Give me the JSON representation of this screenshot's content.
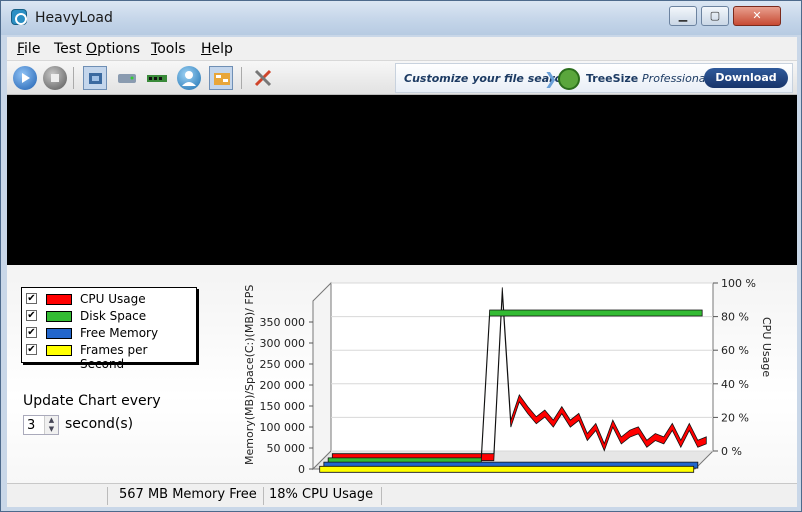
{
  "window": {
    "title": "HeavyLoad"
  },
  "menu": [
    {
      "pre": "",
      "ul": "F",
      "post": "ile"
    },
    {
      "pre": "Test ",
      "ul": "O",
      "post": "ptions"
    },
    {
      "pre": "",
      "ul": "T",
      "post": "ools"
    },
    {
      "pre": "",
      "ul": "H",
      "post": "elp"
    }
  ],
  "toolbar_icons": [
    "start-icon",
    "stop-icon",
    "cpu-icon",
    "disk-icon",
    "memory-icon",
    "fps-icon",
    "settings-icon"
  ],
  "ad": {
    "text": "Customize your file search",
    "brand": "TreeSize",
    "brand_suffix": "Professional",
    "download": "Download"
  },
  "legend": [
    {
      "label": "CPU Usage",
      "color": "#ff0000",
      "checked": "✔"
    },
    {
      "label": "Disk Space",
      "color": "#33bb33",
      "checked": "✔"
    },
    {
      "label": "Free Memory",
      "color": "#2266cc",
      "checked": "✔"
    },
    {
      "label": "Frames per Second",
      "color": "#ffff00",
      "checked": "✔"
    }
  ],
  "update": {
    "label": "Update Chart every",
    "value": "3",
    "unit": "second(s)"
  },
  "chart_data": {
    "type": "line",
    "left_axis_label": "Memory(MB)/Space(C:)(MB)/ FPS",
    "right_axis_label": "CPU Usage",
    "left_ticks": [
      "0",
      "50 000",
      "100 000",
      "150 000",
      "200 000",
      "250 000",
      "300 000",
      "350 000"
    ],
    "left_ylim": [
      0,
      400000
    ],
    "right_ticks": [
      "0 %",
      "20 %",
      "40 %",
      "60 %",
      "80 %",
      "100 %"
    ],
    "right_ylim": [
      0,
      100
    ],
    "x": [
      0,
      1,
      2,
      3,
      4,
      5,
      6,
      7,
      8,
      9,
      10,
      11,
      12,
      13,
      14,
      15,
      16,
      17,
      18,
      19,
      20,
      21,
      22,
      23,
      24,
      25,
      26,
      27,
      28,
      29,
      30,
      31,
      32,
      33,
      34,
      35,
      36,
      37,
      38,
      39,
      40,
      41,
      42,
      43,
      44
    ],
    "series": [
      {
        "name": "CPU Usage",
        "color": "#ff0000",
        "axis": "right",
        "values": [
          0,
          0,
          0,
          0,
          0,
          0,
          0,
          0,
          0,
          0,
          0,
          0,
          0,
          0,
          0,
          0,
          0,
          0,
          0,
          0,
          99,
          20,
          35,
          28,
          22,
          26,
          20,
          28,
          20,
          24,
          12,
          18,
          6,
          20,
          10,
          14,
          16,
          8,
          12,
          10,
          18,
          8,
          18,
          8,
          10
        ]
      },
      {
        "name": "Disk Space",
        "color": "#33bb33",
        "axis": "right",
        "values": [
          0,
          0,
          0,
          0,
          0,
          0,
          0,
          0,
          0,
          0,
          0,
          0,
          0,
          0,
          0,
          0,
          0,
          0,
          0,
          88,
          88,
          88,
          88,
          88,
          88,
          88,
          88,
          88,
          88,
          88,
          88,
          88,
          88,
          88,
          88,
          88,
          88,
          88,
          88,
          88,
          88,
          88,
          88,
          88,
          88
        ]
      },
      {
        "name": "Free Memory",
        "color": "#2266cc",
        "axis": "right",
        "values": [
          0,
          0,
          0,
          0,
          0,
          0,
          0,
          0,
          0,
          0,
          0,
          0,
          0,
          0,
          0,
          0,
          0,
          0,
          0,
          0,
          0,
          0,
          0,
          0,
          0,
          0,
          0,
          0,
          0,
          0,
          0,
          0,
          0,
          0,
          0,
          0,
          0,
          0,
          0,
          0,
          0,
          0,
          0,
          0,
          0
        ]
      },
      {
        "name": "Frames per Second",
        "color": "#ffff00",
        "axis": "right",
        "values": [
          0,
          0,
          0,
          0,
          0,
          0,
          0,
          0,
          0,
          0,
          0,
          0,
          0,
          0,
          0,
          0,
          0,
          0,
          0,
          0,
          0,
          0,
          0,
          0,
          0,
          0,
          0,
          0,
          0,
          0,
          0,
          0,
          0,
          0,
          0,
          0,
          0,
          0,
          0,
          0,
          0,
          0,
          0,
          0,
          0
        ]
      }
    ]
  },
  "status": {
    "memory": "567 MB Memory Free",
    "cpu": "18% CPU Usage"
  }
}
